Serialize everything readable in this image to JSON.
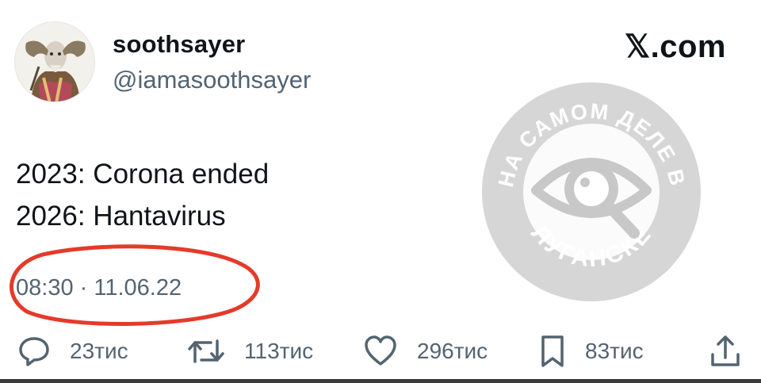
{
  "author": {
    "display_name": "soothsayer",
    "handle": "@iamasoothsayer",
    "avatar_icon": "ram-horned-soothsayer-avatar"
  },
  "brand": "𝕏.com",
  "tweet": {
    "lines": [
      "2023: Corona ended",
      "2026: Hantavirus"
    ],
    "timestamp": "08:30 · 11.06.22"
  },
  "watermark": {
    "top_text": "НА САМОМ ДЕЛЕ В",
    "bottom_text": "ЛУГАНСКЕ",
    "icon": "eye-magnifier-icon"
  },
  "actions": {
    "replies": {
      "count": "23тис",
      "icon": "reply-icon"
    },
    "reposts": {
      "count": "113тис",
      "icon": "repost-icon"
    },
    "likes": {
      "count": "296тис",
      "icon": "heart-icon"
    },
    "bookmarks": {
      "count": "83тис",
      "icon": "bookmark-icon"
    },
    "share": {
      "icon": "share-icon"
    }
  },
  "colors": {
    "text": "#0f1419",
    "secondary": "#536471",
    "highlight": "#e53a2a",
    "watermark": "#c8c8c8"
  }
}
